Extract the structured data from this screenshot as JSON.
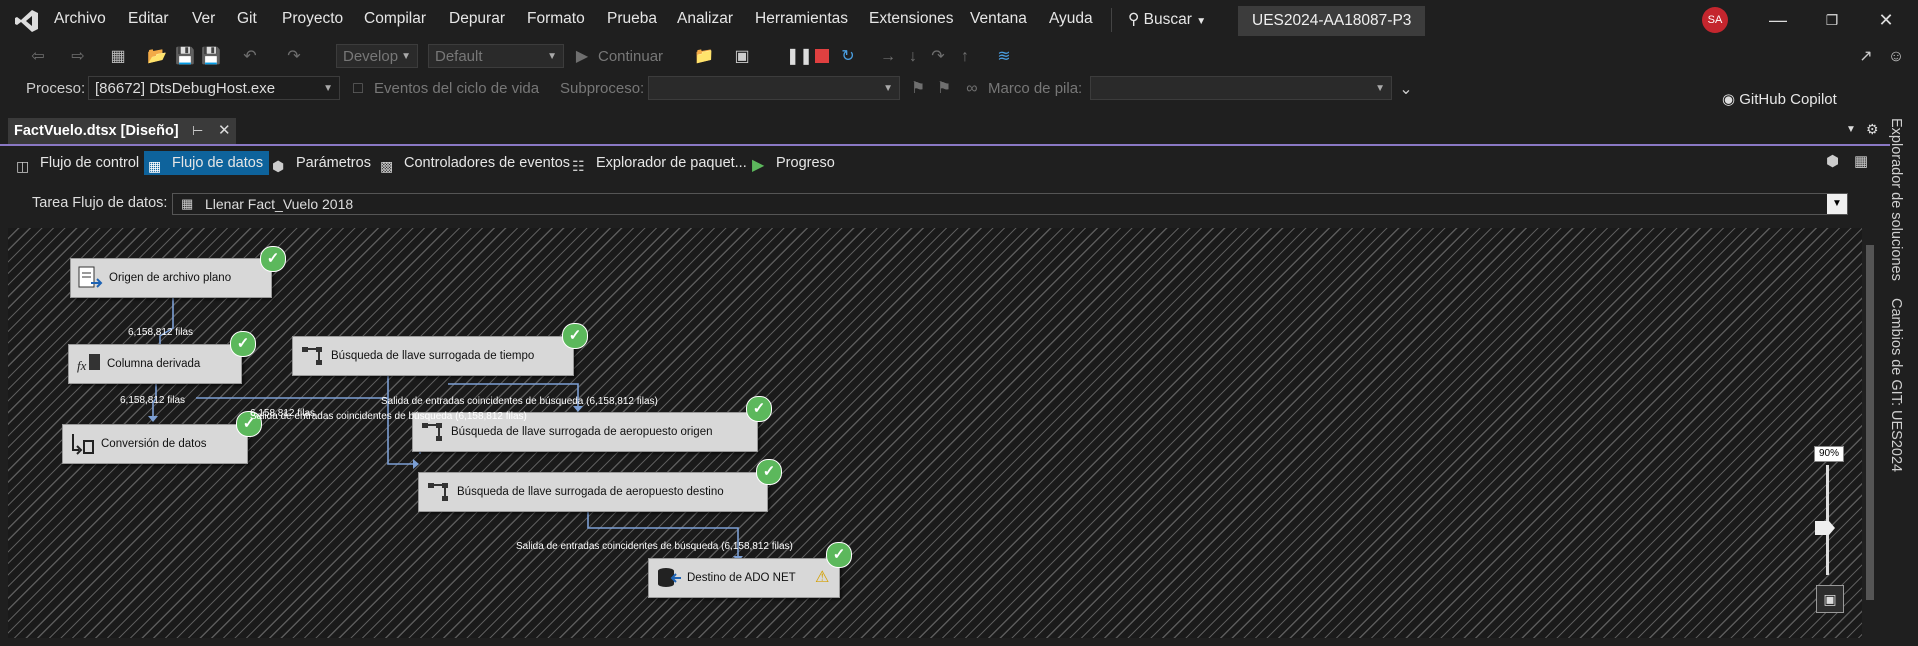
{
  "menu": {
    "items": [
      "Archivo",
      "Editar",
      "Ver",
      "Git",
      "Proyecto",
      "Compilar",
      "Depurar",
      "Formato",
      "Prueba",
      "Analizar",
      "Herramientas",
      "Extensiones",
      "Ventana",
      "Ayuda"
    ],
    "search": "Buscar",
    "solution_name": "UES2024-AA18087-P3",
    "avatar_initials": "SA"
  },
  "toolbar": {
    "config": "Develop",
    "platform": "Default",
    "continue_label": "Continuar",
    "copilot_label": "GitHub Copilot"
  },
  "debug_bar": {
    "process_label": "Proceso:",
    "process_value": "[86672] DtsDebugHost.exe",
    "lifecycle_label": "Eventos del ciclo de vida",
    "subprocess_label": "Subproceso:",
    "stack_label": "Marco de pila:"
  },
  "document": {
    "tab_title": "FactVuelo.dtsx [Diseño]"
  },
  "designer_tabs": [
    {
      "label": "Flujo de control"
    },
    {
      "label": "Flujo de datos"
    },
    {
      "label": "Parámetros"
    },
    {
      "label": "Controladores de eventos"
    },
    {
      "label": "Explorador de paquet..."
    },
    {
      "label": "Progreso"
    }
  ],
  "task": {
    "label": "Tarea Flujo de datos:",
    "value": "Llenar Fact_Vuelo 2018"
  },
  "components": [
    {
      "label": "Origen de archivo plano",
      "status": "success"
    },
    {
      "label": "Columna derivada",
      "status": "success"
    },
    {
      "label": "Conversión de datos",
      "status": "success"
    },
    {
      "label": "Búsqueda de llave surrogada de tiempo",
      "status": "success"
    },
    {
      "label": "Búsqueda de llave surrogada de aeropuesto origen",
      "status": "success"
    },
    {
      "label": "Búsqueda de llave surrogada de aeropuesto destino",
      "status": "success"
    },
    {
      "label": "Destino de ADO NET",
      "status": "success",
      "warning": true
    }
  ],
  "flows": [
    {
      "label": "6,158,812 filas"
    },
    {
      "label": "6,158,812 filas"
    },
    {
      "label": "6,158,812 filas"
    },
    {
      "label": "Salida de entradas coincidentes de búsqueda (6,158,812 filas)"
    },
    {
      "label": "Salida de entradas coincidentes de búsqueda (6,158,812 filas)"
    },
    {
      "label": "Salida de entradas coincidentes de búsqueda (6,158,812 filas)"
    }
  ],
  "side_panels": {
    "solution_explorer": "Explorador de soluciones",
    "git_changes": "Cambios de GIT: UES2024"
  },
  "zoom": {
    "level_label": "90%",
    "level": 0.9
  },
  "colors": {
    "accent": "#0e639c",
    "success": "#5cb85c",
    "tab_underline": "#8a78c4"
  }
}
